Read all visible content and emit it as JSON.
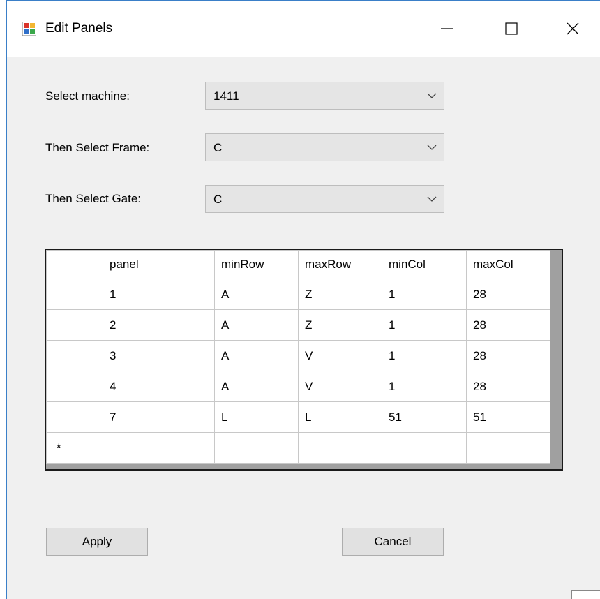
{
  "window": {
    "title": "Edit Panels",
    "controls": {
      "minimize": "minimize-icon",
      "maximize": "maximize-icon",
      "close": "close-icon"
    }
  },
  "form": {
    "machine_label": "Select machine:",
    "machine_value": "1411",
    "frame_label": "Then Select Frame:",
    "frame_value": "C",
    "gate_label": "Then Select Gate:",
    "gate_value": "C"
  },
  "grid": {
    "columns": [
      "panel",
      "minRow",
      "maxRow",
      "minCol",
      "maxCol"
    ],
    "rows": [
      [
        "1",
        "A",
        "Z",
        "1",
        "28"
      ],
      [
        "2",
        "A",
        "Z",
        "1",
        "28"
      ],
      [
        "3",
        "A",
        "V",
        "1",
        "28"
      ],
      [
        "4",
        "A",
        "V",
        "1",
        "28"
      ],
      [
        "7",
        "L",
        "L",
        "51",
        "51"
      ]
    ],
    "new_row_marker": "*"
  },
  "buttons": {
    "apply": "Apply",
    "cancel": "Cancel"
  },
  "colors": {
    "window_border": "#3a7fc8",
    "background": "#f0f0f0",
    "combo_bg": "#e5e5e5",
    "button_bg": "#e1e1e1"
  }
}
